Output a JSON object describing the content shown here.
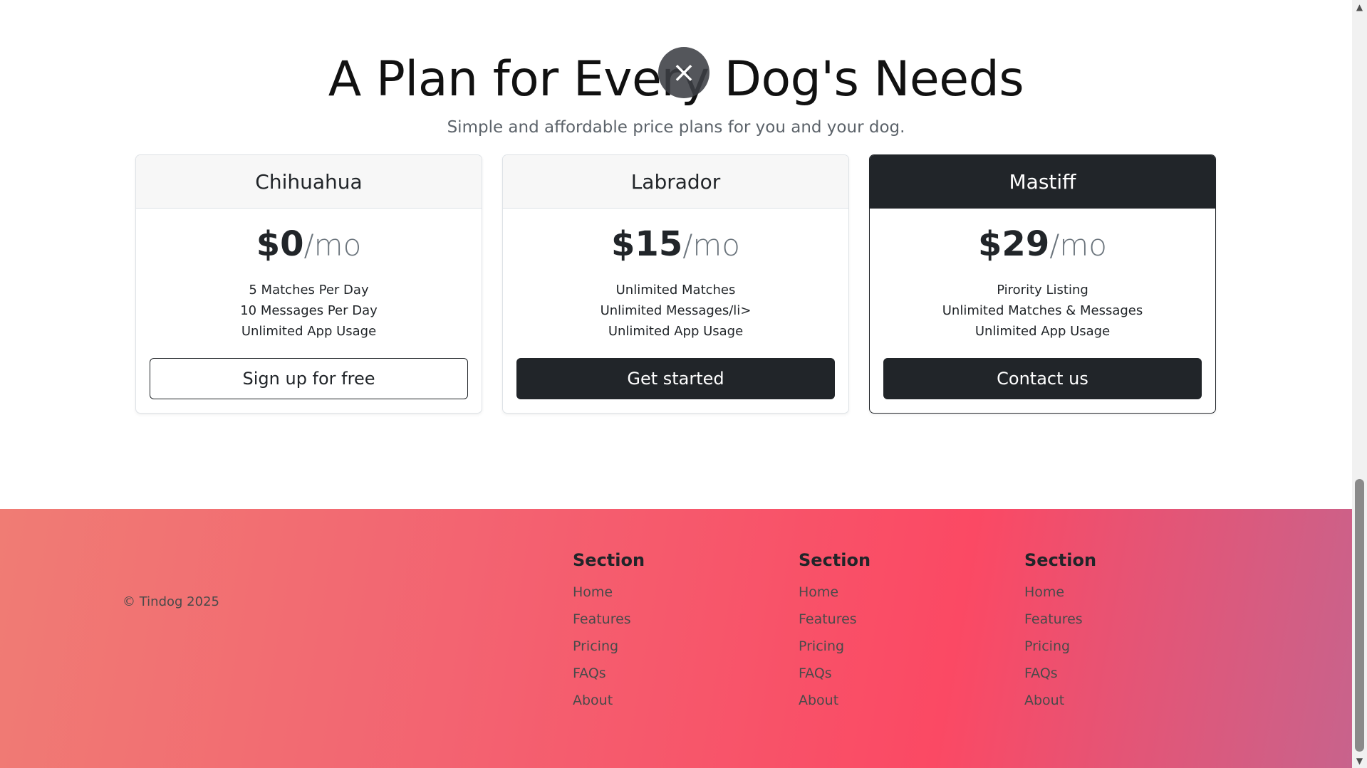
{
  "pricing": {
    "title": "A Plan for Every Dog's Needs",
    "subtitle": "Simple and affordable price plans for you and your dog.",
    "close_icon": "×",
    "plans": [
      {
        "name": "Chihuahua",
        "price": "$0",
        "period": "/mo",
        "features": [
          "5 Matches Per Day",
          "10 Messages Per Day",
          "Unlimited App Usage"
        ],
        "button": "Sign up for free"
      },
      {
        "name": "Labrador",
        "price": "$15",
        "period": "/mo",
        "features": [
          "Unlimited Matches",
          "Unlimited Messages/li>",
          "Unlimited App Usage"
        ],
        "button": "Get started"
      },
      {
        "name": "Mastiff",
        "price": "$29",
        "period": "/mo",
        "features": [
          "Pirority Listing",
          "Unlimited Matches & Messages",
          "Unlimited App Usage"
        ],
        "button": "Contact us"
      }
    ]
  },
  "footer": {
    "copyright": "© Tindog 2025",
    "columns": [
      {
        "heading": "Section",
        "links": [
          "Home",
          "Features",
          "Pricing",
          "FAQs",
          "About"
        ]
      },
      {
        "heading": "Section",
        "links": [
          "Home",
          "Features",
          "Pricing",
          "FAQs",
          "About"
        ]
      },
      {
        "heading": "Section",
        "links": [
          "Home",
          "Features",
          "Pricing",
          "FAQs",
          "About"
        ]
      }
    ]
  },
  "scrollbar": {
    "up_icon": "▲",
    "down_icon": "▼"
  },
  "colors": {
    "dark": "#212529",
    "footer_gradient_start": "#f07c74",
    "footer_gradient_mid": "#fb4964",
    "footer_gradient_end": "#c8638c"
  }
}
